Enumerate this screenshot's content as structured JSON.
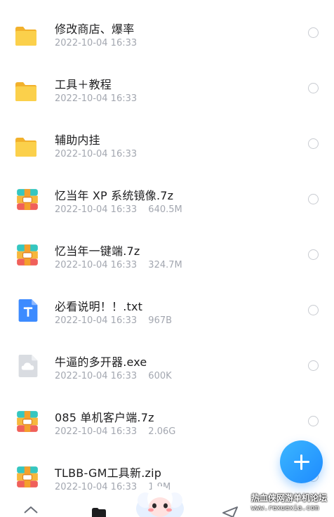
{
  "files": [
    {
      "type": "folder",
      "icon": "folder-icon",
      "name": "修改商店、爆率",
      "date": "2022-10-04 16:33",
      "size": ""
    },
    {
      "type": "folder",
      "icon": "folder-icon",
      "name": "工具＋教程",
      "date": "2022-10-04 16:33",
      "size": ""
    },
    {
      "type": "folder",
      "icon": "folder-icon",
      "name": "辅助内挂",
      "date": "2022-10-04 16:33",
      "size": ""
    },
    {
      "type": "archive",
      "icon": "archive-icon",
      "name": "忆当年 XP 系统镜像.7z",
      "date": "2022-10-04 16:33",
      "size": "640.5M"
    },
    {
      "type": "archive",
      "icon": "archive-icon",
      "name": "忆当年一键端.7z",
      "date": "2022-10-04 16:33",
      "size": "324.7M"
    },
    {
      "type": "txt",
      "icon": "text-file-icon",
      "name": "必看说明！！.txt",
      "date": "2022-10-04 16:33",
      "size": "967B"
    },
    {
      "type": "exe",
      "icon": "cloud-file-icon",
      "name": "牛逼的多开器.exe",
      "date": "2022-10-04 16:33",
      "size": "600K"
    },
    {
      "type": "archive",
      "icon": "archive-icon",
      "name": "085 单机客户端.7z",
      "date": "2022-10-04 16:33",
      "size": "2.06G"
    },
    {
      "type": "archive",
      "icon": "archive-icon",
      "name": "TLBB-GM工具新.zip",
      "date": "2022-10-04 16:33",
      "size": "1.9M"
    }
  ],
  "fab": {
    "icon": "plus-icon"
  },
  "tabbar": {
    "icons": [
      "home-icon",
      "files-icon",
      "mascot-icon",
      "send-icon"
    ]
  },
  "watermark": {
    "title": "热血侠网游单机论坛",
    "url": "www.rexuexia.com"
  },
  "colors": {
    "accent": "#1e8bff",
    "folder": "#f7c23a",
    "text": "#1d1d1f",
    "meta": "#a3a7b0"
  }
}
